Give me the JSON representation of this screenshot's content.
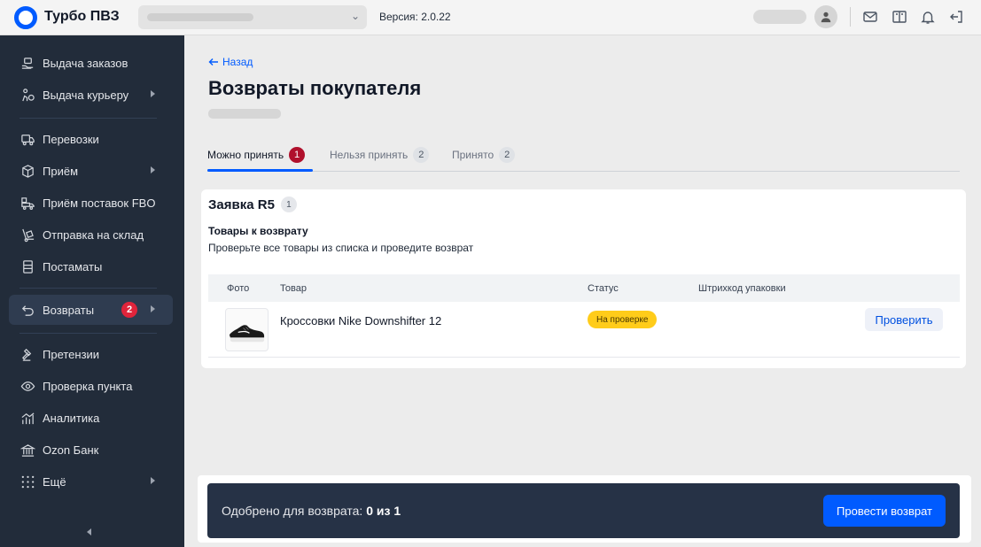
{
  "topbar": {
    "brand": "Турбо ПВЗ",
    "version": "Версия: 2.0.22"
  },
  "sidebar": {
    "items": [
      {
        "label": "Выдача заказов",
        "icon": "box-hand-icon"
      },
      {
        "label": "Выдача курьеру",
        "icon": "courier-icon",
        "has_arrow": true
      },
      {
        "label": "Перевозки",
        "icon": "truck-icon"
      },
      {
        "label": "Приём",
        "icon": "package-icon",
        "has_arrow": true
      },
      {
        "label": "Приём поставок FBO",
        "icon": "truck-box-icon"
      },
      {
        "label": "Отправка на склад",
        "icon": "dolly-icon"
      },
      {
        "label": "Постаматы",
        "icon": "locker-icon"
      },
      {
        "label": "Возвраты",
        "icon": "return-icon",
        "badge": "2",
        "has_arrow": true,
        "active": true
      },
      {
        "label": "Претензии",
        "icon": "gavel-icon"
      },
      {
        "label": "Проверка пункта",
        "icon": "eye-icon"
      },
      {
        "label": "Аналитика",
        "icon": "chart-icon"
      },
      {
        "label": "Ozon Банк",
        "icon": "bank-icon"
      },
      {
        "label": "Ещё",
        "icon": "grid-dots-icon",
        "has_arrow": true
      }
    ]
  },
  "main": {
    "back_label": "Назад",
    "title": "Возвраты покупателя",
    "tabs": [
      {
        "label": "Можно принять",
        "count": "1"
      },
      {
        "label": "Нельзя принять",
        "count": "2"
      },
      {
        "label": "Принято",
        "count": "2"
      }
    ],
    "card": {
      "title": "Заявка R5",
      "count": "1",
      "heading": "Товары к возврату",
      "description": "Проверьте все товары из списка и проведите возврат",
      "columns": [
        "Фото",
        "Товар",
        "Статус",
        "Штрихкод упаковки"
      ],
      "rows": [
        {
          "product": "Кроссовки Nike Downshifter 12",
          "status": "На проверке",
          "action": "Проверить"
        }
      ]
    }
  },
  "footer": {
    "approved_label": "Одобрено для возврата:",
    "approved_value": "0 из 1",
    "submit_label": "Провести возврат"
  },
  "colors": {
    "accent": "#005bff",
    "sidebar": "#222c3a",
    "badge": "#e0243b",
    "status": "#ffcc1a"
  }
}
